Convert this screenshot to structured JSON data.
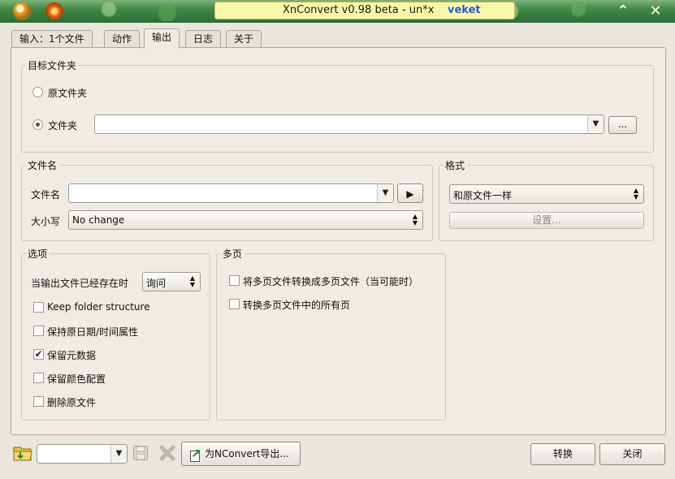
{
  "window": {
    "title": "XnConvert v0.98 beta - un*x",
    "user": "veket"
  },
  "tabs": [
    {
      "label": "输入：1个文件",
      "active": false
    },
    {
      "label": "动作",
      "active": false
    },
    {
      "label": "输出",
      "active": true
    },
    {
      "label": "日志",
      "active": false
    },
    {
      "label": "关于",
      "active": false
    }
  ],
  "target_folder": {
    "title": "目标文件夹",
    "option_original": "原文件夹",
    "option_folder": "文件夹",
    "selected": "文件夹",
    "folder_value": "",
    "browse_label": "..."
  },
  "filename": {
    "title": "文件名",
    "name_label": "文件名",
    "name_value": "",
    "case_label": "大小写",
    "case_value": "No change"
  },
  "format": {
    "title": "格式",
    "value": "和原文件一样",
    "settings_label": "设置..."
  },
  "options": {
    "title": "选项",
    "exists_label": "当输出文件已经存在时",
    "exists_value": "询问",
    "checks": [
      {
        "label": "Keep folder structure",
        "checked": false
      },
      {
        "label": "保持原日期/时间属性",
        "checked": false
      },
      {
        "label": "保留元数据",
        "checked": true
      },
      {
        "label": "保留颜色配置",
        "checked": false
      },
      {
        "label": "删除原文件",
        "checked": false
      }
    ]
  },
  "multipage": {
    "title": "多页",
    "checks": [
      {
        "label": "将多页文件转换成多页文件（当可能时）",
        "checked": false
      },
      {
        "label": "转换多页文件中的所有页",
        "checked": false
      }
    ]
  },
  "bottom": {
    "preset_value": "",
    "export_label": "为NConvert导出...",
    "convert_label": "转换",
    "close_label": "关闭"
  },
  "colors": {
    "titlebar": "#3f8a45",
    "title_pill": "#fbf7a6",
    "user_text": "#2c5ad8"
  }
}
